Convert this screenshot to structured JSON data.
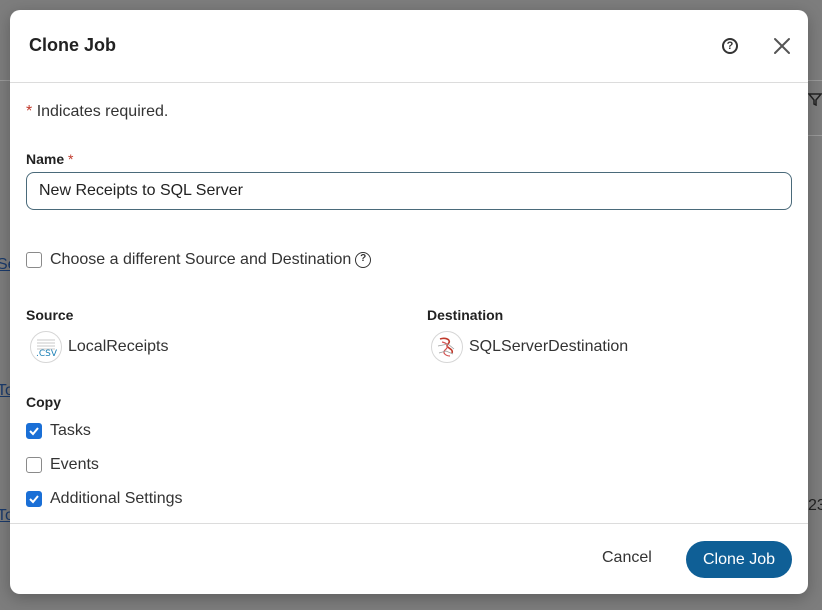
{
  "background": {
    "fragments": [
      "Se",
      "To",
      "To",
      "23"
    ]
  },
  "dialog": {
    "title": "Clone Job",
    "help_icon": "help-circle-icon",
    "close_icon": "close-icon",
    "required_note": {
      "asterisk": "*",
      "text": "Indicates required."
    },
    "name": {
      "label": "Name",
      "required_mark": "*",
      "value": "New Receipts to SQL Server"
    },
    "choose_different": {
      "label": "Choose a different Source and Destination",
      "checked": false
    },
    "source": {
      "label": "Source",
      "name": "LocalReceipts",
      "icon": "csv-file-icon",
      "icon_text": ".CSV"
    },
    "destination": {
      "label": "Destination",
      "name": "SQLServerDestination",
      "icon": "sql-server-icon"
    },
    "copy": {
      "label": "Copy",
      "options": [
        {
          "label": "Tasks",
          "checked": true
        },
        {
          "label": "Events",
          "checked": false
        },
        {
          "label": "Additional Settings",
          "checked": true
        }
      ]
    },
    "footer": {
      "cancel_label": "Cancel",
      "submit_label": "Clone Job"
    },
    "colors": {
      "primary": "#0f5f96",
      "checkbox": "#1a6fd6",
      "required": "#c0392b"
    }
  }
}
